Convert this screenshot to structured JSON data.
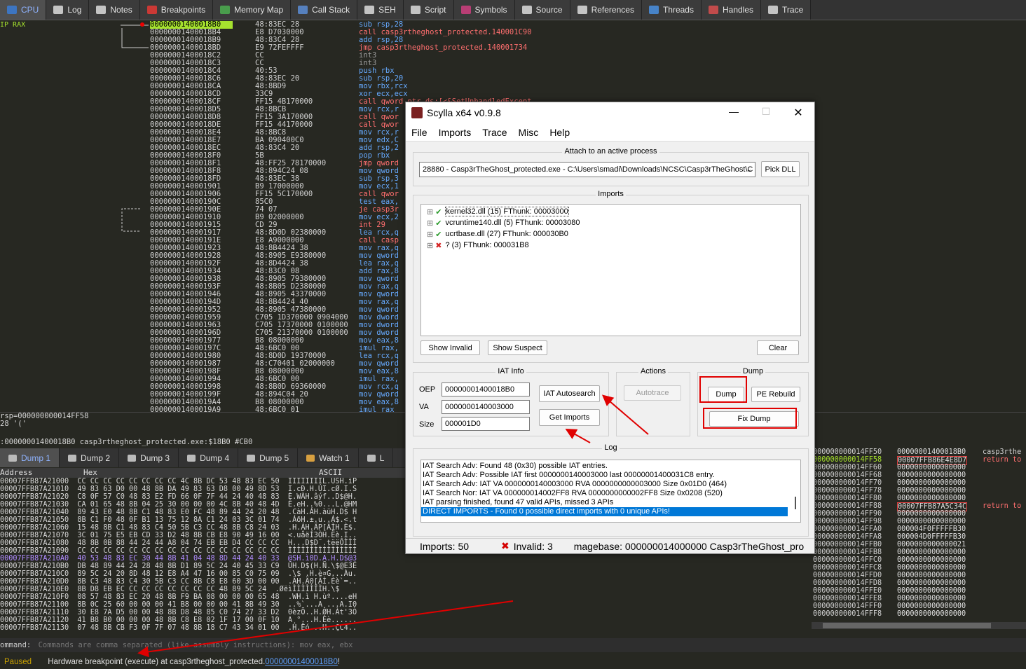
{
  "tabs": [
    {
      "label": "CPU",
      "icon": "cpu-icon",
      "color": "#3a7bd5"
    },
    {
      "label": "Log",
      "icon": "log-icon",
      "color": "#dddddd"
    },
    {
      "label": "Notes",
      "icon": "notes-icon",
      "color": "#dddddd"
    },
    {
      "label": "Breakpoints",
      "icon": "breakpoint-icon",
      "color": "#e53935"
    },
    {
      "label": "Memory Map",
      "icon": "memory-map-icon",
      "color": "#4caf50"
    },
    {
      "label": "Call Stack",
      "icon": "call-stack-icon",
      "color": "#5c8dd6"
    },
    {
      "label": "SEH",
      "icon": "seh-icon",
      "color": "#dddddd"
    },
    {
      "label": "Script",
      "icon": "script-icon",
      "color": "#dddddd"
    },
    {
      "label": "Symbols",
      "icon": "symbols-icon",
      "color": "#d04080"
    },
    {
      "label": "Source",
      "icon": "source-icon",
      "color": "#dddddd"
    },
    {
      "label": "References",
      "icon": "references-icon",
      "color": "#dddddd"
    },
    {
      "label": "Threads",
      "icon": "threads-icon",
      "color": "#4a90e2"
    },
    {
      "label": "Handles",
      "icon": "handles-icon",
      "color": "#d94f4f"
    },
    {
      "label": "Trace",
      "icon": "trace-icon",
      "color": "#dddddd"
    }
  ],
  "regs": "IP RAX",
  "disasm": [
    {
      "a": "00000001400018B0",
      "b": "48:83EC 28",
      "d": "sub rsp,28",
      "c": "b"
    },
    {
      "a": "00000001400018B4",
      "b": "E8 D7030000",
      "d": "call casp3rtheghost_protected.140001C90",
      "c": "r"
    },
    {
      "a": "00000001400018B9",
      "b": "48:83C4 28",
      "d": "add rsp,28",
      "c": "b"
    },
    {
      "a": "00000001400018BD",
      "b": "E9 72FEFFFF",
      "d": "jmp casp3rtheghost_protected.140001734",
      "c": "r"
    },
    {
      "a": "00000001400018C2",
      "b": "CC",
      "d": "int3",
      "c": "g"
    },
    {
      "a": "00000001400018C3",
      "b": "CC",
      "d": "int3",
      "c": "g"
    },
    {
      "a": "00000001400018C4",
      "b": "40:53",
      "d": "push rbx",
      "c": "b"
    },
    {
      "a": "00000001400018C6",
      "b": "48:83EC 20",
      "d": "sub rsp,20",
      "c": "b"
    },
    {
      "a": "00000001400018CA",
      "b": "48:8BD9",
      "d": "mov rbx,rcx",
      "c": "b"
    },
    {
      "a": "00000001400018CD",
      "b": "33C9",
      "d": "xor ecx,ecx",
      "c": "b"
    },
    {
      "a": "00000001400018CF",
      "b": "FF15 4B170000",
      "d": "call qword ptr ds:[<&SetUnhandledExcept",
      "c": "r"
    },
    {
      "a": "00000001400018D5",
      "b": "48:8BCB",
      "d": "mov rcx,r",
      "c": "b"
    },
    {
      "a": "00000001400018D8",
      "b": "FF15 3A170000",
      "d": "call qwor",
      "c": "r"
    },
    {
      "a": "00000001400018DE",
      "b": "FF15 44170000",
      "d": "call qwor",
      "c": "r"
    },
    {
      "a": "00000001400018E4",
      "b": "48:8BC8",
      "d": "mov rcx,r",
      "c": "b"
    },
    {
      "a": "00000001400018E7",
      "b": "BA 090400C0",
      "d": "mov edx,C",
      "c": "b"
    },
    {
      "a": "00000001400018EC",
      "b": "48:83C4 20",
      "d": "add rsp,2",
      "c": "b"
    },
    {
      "a": "00000001400018F0",
      "b": "5B",
      "d": "pop rbx",
      "c": "b"
    },
    {
      "a": "00000001400018F1",
      "b": "48:FF25 78170000",
      "d": "jmp qword",
      "c": "r"
    },
    {
      "a": "00000001400018F8",
      "b": "48:894C24 08",
      "d": "mov qword",
      "c": "b"
    },
    {
      "a": "00000001400018FD",
      "b": "48:83EC 38",
      "d": "sub rsp,3",
      "c": "b"
    },
    {
      "a": "0000000140001901",
      "b": "B9 17000000",
      "d": "mov ecx,1",
      "c": "b"
    },
    {
      "a": "0000000140001906",
      "b": "FF15 5C170000",
      "d": "call qwor",
      "c": "r"
    },
    {
      "a": "000000014000190C",
      "b": "85C0",
      "d": "test eax,",
      "c": "b"
    },
    {
      "a": "000000014000190E",
      "b": "74 07",
      "d": "je casp3r",
      "c": "r"
    },
    {
      "a": "0000000140001910",
      "b": "B9 02000000",
      "d": "mov ecx,2",
      "c": "b"
    },
    {
      "a": "0000000140001915",
      "b": "CD 29",
      "d": "int 29",
      "c": "r"
    },
    {
      "a": "0000000140001917",
      "b": "48:8D0D 02380000",
      "d": "lea rcx,q",
      "c": "b"
    },
    {
      "a": "000000014000191E",
      "b": "E8 A9000000",
      "d": "call casp",
      "c": "r"
    },
    {
      "a": "0000000140001923",
      "b": "48:8B4424 38",
      "d": "mov rax,q",
      "c": "b"
    },
    {
      "a": "0000000140001928",
      "b": "48:8905 E9380000",
      "d": "mov qword",
      "c": "b"
    },
    {
      "a": "000000014000192F",
      "b": "48:8D4424 38",
      "d": "lea rax,q",
      "c": "b"
    },
    {
      "a": "0000000140001934",
      "b": "48:83C0 08",
      "d": "add rax,8",
      "c": "b"
    },
    {
      "a": "0000000140001938",
      "b": "48:8905 79380000",
      "d": "mov qword",
      "c": "b"
    },
    {
      "a": "000000014000193F",
      "b": "48:8B05 D2380000",
      "d": "mov rax,q",
      "c": "b"
    },
    {
      "a": "0000000140001946",
      "b": "48:8905 43370000",
      "d": "mov qword",
      "c": "b"
    },
    {
      "a": "000000014000194D",
      "b": "48:8B4424 40",
      "d": "mov rax,q",
      "c": "b"
    },
    {
      "a": "0000000140001952",
      "b": "48:8905 47380000",
      "d": "mov qword",
      "c": "b"
    },
    {
      "a": "0000000140001959",
      "b": "C705 1D370000 0904000",
      "d": "mov dword",
      "c": "b"
    },
    {
      "a": "0000000140001963",
      "b": "C705 17370000 0100000",
      "d": "mov dword",
      "c": "b"
    },
    {
      "a": "000000014000196D",
      "b": "C705 21370000 0100000",
      "d": "mov dword",
      "c": "b"
    },
    {
      "a": "0000000140001977",
      "b": "B8 08000000",
      "d": "mov eax,8",
      "c": "b"
    },
    {
      "a": "000000014000197C",
      "b": "48:6BC0 00",
      "d": "imul rax,",
      "c": "b"
    },
    {
      "a": "0000000140001980",
      "b": "48:8D0D 19370000",
      "d": "lea rcx,q",
      "c": "b"
    },
    {
      "a": "0000000140001987",
      "b": "48:C70401 02000000",
      "d": "mov qword",
      "c": "b"
    },
    {
      "a": "000000014000198F",
      "b": "B8 08000000",
      "d": "mov eax,8",
      "c": "b"
    },
    {
      "a": "0000000140001994",
      "b": "48:6BC0 00",
      "d": "imul rax,",
      "c": "b"
    },
    {
      "a": "0000000140001998",
      "b": "48:8B0D 69360000",
      "d": "mov rcx,q",
      "c": "b"
    },
    {
      "a": "000000014000199F",
      "b": "48:894C04 20",
      "d": "mov qword",
      "c": "b"
    },
    {
      "a": "00000001400019A4",
      "b": "B8 08000000",
      "d": "mov eax,8",
      "c": "b"
    },
    {
      "a": "00000001400019A9",
      "b": "48:6BC0 01",
      "d": "imul rax",
      "c": "b"
    }
  ],
  "info_lines": [
    "rsp=000000000014FF58",
    "28 '('",
    "     :00000001400018B0 casp3rtheghost_protected.exe:$18B0 #CB0"
  ],
  "dump_tabs": [
    {
      "label": "Dump 1"
    },
    {
      "label": "Dump 2"
    },
    {
      "label": "Dump 3"
    },
    {
      "label": "Dump 4"
    },
    {
      "label": "Dump 5"
    },
    {
      "label": "Watch 1"
    },
    {
      "label": "L"
    }
  ],
  "dump_headers": {
    "address": "Address",
    "hex": "Hex",
    "ascii": "ASCII"
  },
  "dump_rows": [
    "00007FFB87A21000  CC CC CC CC CC CC CC CC 4C 8B DC 53 48 83 EC 50  ÌÌÌÌÌÌÌÌL.USH.ìP",
    "00007FFB87A21010  49 83 63 D0 00 48 8B DA 49 83 63 D8 00 49 8D 53  I.cÐ.H.ÚI.cØ.I.S",
    "00007FFB87A21020  C8 0F 57 C0 48 83 E2 FD 66 0F 7F 44 24 40 48 83  È.WÀH.âýf..D$@H.",
    "00007FFB87A21030  CA 01 65 48 8B 04 25 30 00 00 00 4C 8B 40 48 4D  Ê.eH..%0...L.@HM",
    "00007FFB87A21040  89 43 E0 48 8B C1 48 83 E0 FC 48 89 44 24 20 48  .CàH.ÁH.àüH.D$ H",
    "00007FFB87A21050  8B C1 F0 48 0F B1 13 75 12 8A C1 24 03 3C 01 74  .ÁðH.±.u..Á$.<.t",
    "00007FFB87A21060  15 48 8B C1 48 83 C4 50 5B C3 CC 48 8B C8 24 03  .H.ÁH.ÄP[ÃÌH.È$.",
    "00007FFB87A21070  3C 01 75 E5 EB CD 33 D2 48 8B CB E8 90 49 16 00  <.uåëÍ3ÒH.Ëè.I..",
    "00007FFB87A21080  48 8B 0B 88 44 24 44 A8 04 74 EB EB D4 CC CC CC  H...D$D¨.tëëÔÌÌÌ",
    "00007FFB87A21090  CC CC CC CC CC CC CC CC CC CC CC CC CC CC CC CC  ÌÌÌÌÌÌÌÌÌÌÌÌÌÌÌÌ",
    "00007FFB87A210A0  40 53 48 83 EC 30 44 8B 41 04 48 8D 44 24 40 33  @SH.ì0D.A.H.D$@3",
    "00007FFB87A210B0  DB 48 89 44 24 28 48 8B D1 89 5C 24 40 45 33 C9  ÛH.D$(H.Ñ.\\$@E3É",
    "00007FFB87A210C0  89 5C 24 20 8D 48 12 E8 A4 47 16 00 85 C0 75 09  .\\$ .H.è¤G...Àu.",
    "00007FFB87A210D0  8B C3 48 83 C4 30 5B C3 CC 8B C8 E8 60 3D 00 00  .ÃH.Ä0[ÃÌ.Èè`=..",
    "00007FFB87A210E0  8B D8 EB EC CC CC CC CC CC CC CC 48 89 5C 24  .ØëìÌÌÌÌÌÌÌH.\\$",
    "00007FFB87A210F0  08 57 48 83 EC 20 48 8B F9 BA 08 00 00 00 65 48  .WH.ì H.ùº....eH",
    "00007FFB87A21100  8B 0C 25 60 00 00 00 41 B8 00 00 00 41 8B 49 30  ..%`...A¸...A.I0",
    "00007FFB87A21110  30 E8 7A D5 00 00 48 8B D8 48 85 C0 74 27 33 D2  0èzÕ..H.ØH.Àt'3Ò",
    "00007FFB87A21120  41 B8 B0 00 00 00 48 8B C8 E8 02 1F 17 00 0F 10  A¸°...H.Èè......",
    "00007FFB87A21130  07 48 8B CB F3 0F 7F 07 48 8B 18 C7 43 34 01 00  .H.Ëó...H..ÇC4.."
  ],
  "stack_rows": [
    {
      "a": "000000000014FF50",
      "v": "00000001400018B0",
      "c": "casp3rthe"
    },
    {
      "a": "000000000014FF58",
      "v": "00007FFB86E4E8D7",
      "c": "return to"
    },
    {
      "a": "000000000014FF60",
      "v": "0000000000000000",
      "c": ""
    },
    {
      "a": "000000000014FF68",
      "v": "0000000000000000",
      "c": ""
    },
    {
      "a": "000000000014FF70",
      "v": "0000000000000000",
      "c": ""
    },
    {
      "a": "000000000014FF78",
      "v": "0000000000000000",
      "c": ""
    },
    {
      "a": "000000000014FF80",
      "v": "0000000000000000",
      "c": ""
    },
    {
      "a": "000000000014FF88",
      "v": "00007FFB87A5C34C",
      "c": "return to"
    },
    {
      "a": "000000000014FF90",
      "v": "0000000000000000",
      "c": ""
    },
    {
      "a": "000000000014FF98",
      "v": "0000000000000000",
      "c": ""
    },
    {
      "a": "000000000014FFA0",
      "v": "000004F0FFFFFB30",
      "c": ""
    },
    {
      "a": "000000000014FFA8",
      "v": "000004D0FFFFFB30",
      "c": ""
    },
    {
      "a": "000000000014FFB0",
      "v": "0000000000000021",
      "c": ""
    },
    {
      "a": "000000000014FFB8",
      "v": "0000000000000000",
      "c": ""
    },
    {
      "a": "000000000014FFC0",
      "v": "0000000000000000",
      "c": ""
    },
    {
      "a": "000000000014FFC8",
      "v": "0000000000000000",
      "c": ""
    },
    {
      "a": "000000000014FFD0",
      "v": "0000000000000000",
      "c": ""
    },
    {
      "a": "000000000014FFD8",
      "v": "0000000000000000",
      "c": ""
    },
    {
      "a": "000000000014FFE0",
      "v": "0000000000000000",
      "c": ""
    },
    {
      "a": "000000000014FFE8",
      "v": "0000000000000000",
      "c": ""
    },
    {
      "a": "000000000014FFF0",
      "v": "0000000000000000",
      "c": ""
    },
    {
      "a": "000000000014FFF8",
      "v": "0000000000000000",
      "c": ""
    }
  ],
  "command": {
    "label": "ommand:",
    "placeholder": "Commands are comma separated (like assembly instructions): mov eax, ebx"
  },
  "status": {
    "state": "Paused",
    "message": "Hardware breakpoint (execute) at casp3rtheghost_protected.",
    "link": "00000001400018B0",
    "tail": "!"
  },
  "scylla": {
    "title": "Scylla x64 v0.9.8",
    "menu": [
      "File",
      "Imports",
      "Trace",
      "Misc",
      "Help"
    ],
    "attach_title": "Attach to an active process",
    "process": "28880 - Casp3rTheGhost_protected.exe - C:\\Users\\smadi\\Downloads\\NCSC\\Casp3rTheGhost\\C",
    "pick_dll": "Pick DLL",
    "imports_title": "Imports",
    "imports": [
      {
        "label": "kernel32.dll (15) FThunk: 00003000",
        "ok": true
      },
      {
        "label": "vcruntime140.dll (5) FThunk: 00003080",
        "ok": true
      },
      {
        "label": "ucrtbase.dll (27) FThunk: 000030B0",
        "ok": true
      },
      {
        "label": "? (3) FThunk: 000031B8",
        "ok": false
      }
    ],
    "show_invalid": "Show Invalid",
    "show_suspect": "Show Suspect",
    "clear": "Clear",
    "iat_title": "IAT Info",
    "oep_label": "OEP",
    "oep": "00000001400018B0",
    "va_label": "VA",
    "va": "0000000140003000",
    "size_label": "Size",
    "size": "000001D0",
    "iat_autosearch": "IAT Autosearch",
    "get_imports": "Get Imports",
    "actions_title": "Actions",
    "autotrace": "Autotrace",
    "dump_title": "Dump",
    "dump": "Dump",
    "pe_rebuild": "PE Rebuild",
    "fix_dump": "Fix Dump",
    "log_title": "Log",
    "log": [
      "IAT Search Adv: Found 48 (0x30) possible IAT entries.",
      "IAT Search Adv: Possible IAT first 0000000140003000 last 00000001400031C8 entry.",
      "IAT Search Adv: IAT VA 0000000140003000 RVA 0000000000003000 Size 0x01D0 (464)",
      "IAT Search Nor: IAT VA 000000014002FF8 RVA 0000000000002FF8 Size 0x0208 (520)",
      "IAT parsing finished, found 47 valid APIs, missed 3 APIs",
      "DIRECT IMPORTS - Found 0 possible direct imports with 0 unique APIs!"
    ],
    "status_imports": "Imports: 50",
    "status_invalid": "Invalid: 3",
    "status_base": "magebase: 000000014000000  Casp3rTheGhost_pro"
  }
}
